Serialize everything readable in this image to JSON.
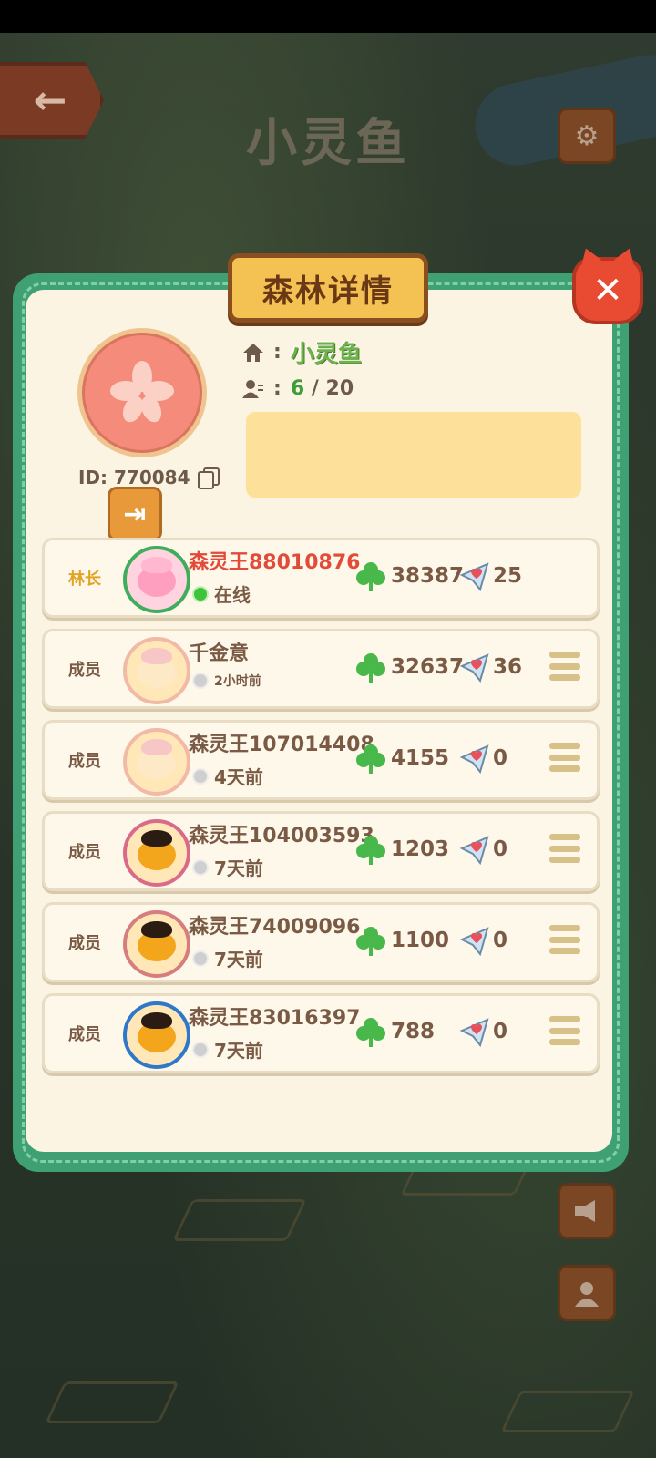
{
  "page": {
    "title": "小灵鱼"
  },
  "dialog": {
    "title": "森林详情",
    "forest_name": "小灵鱼",
    "members_current": "6",
    "members_separator": "/",
    "members_max": "20",
    "id_text": "ID: 770084",
    "notice": ""
  },
  "members": [
    {
      "role": "林长",
      "name": "森灵王88010876",
      "status": "在线",
      "score": "38387",
      "likes": "25"
    },
    {
      "role": "成员",
      "name": "千金意",
      "status": "2小时前",
      "score": "32637",
      "likes": "36"
    },
    {
      "role": "成员",
      "name": "森灵王107014408",
      "status": "4天前",
      "score": "4155",
      "likes": "0"
    },
    {
      "role": "成员",
      "name": "森灵王104003593",
      "status": "7天前",
      "score": "1203",
      "likes": "0"
    },
    {
      "role": "成员",
      "name": "森灵王74009096",
      "status": "7天前",
      "score": "1100",
      "likes": "0"
    },
    {
      "role": "成员",
      "name": "森灵王83016397",
      "status": "7天前",
      "score": "788",
      "likes": "0"
    }
  ],
  "colors": {
    "panel_green": "#3fa173",
    "title_gold": "#f4c153",
    "close_red": "#e94a32",
    "leader_name": "#e24b3a",
    "online_green": "#3fc33a"
  },
  "icons": [
    "back-arrow-icon",
    "settings-gear-icon",
    "close-icon",
    "home-icon",
    "members-icon",
    "copy-icon",
    "exit-icon",
    "clover-icon",
    "heart-plane-icon",
    "menu-icon",
    "announcement-icon",
    "profile-icon"
  ]
}
